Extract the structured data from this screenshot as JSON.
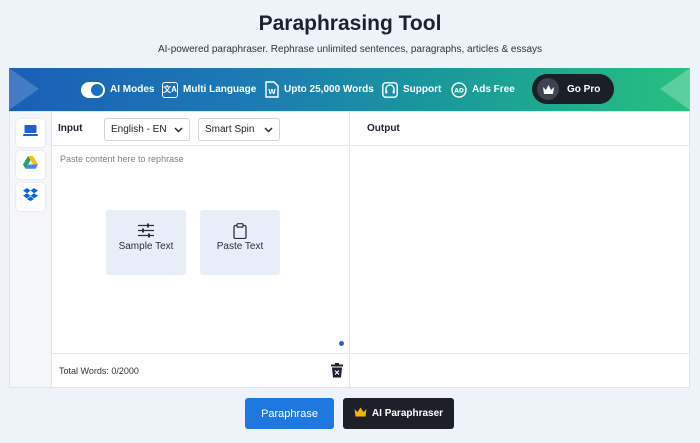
{
  "page": {
    "title": "Paraphrasing Tool",
    "subtitle": "AI-powered paraphraser. Rephrase unlimited sentences, paragraphs, articles & essays"
  },
  "banner": {
    "features": [
      {
        "label": "AI Modes",
        "icon": "toggle-icon"
      },
      {
        "label": "Multi Language",
        "icon": "translate-icon"
      },
      {
        "label": "Upto 25,000 Words",
        "icon": "word-doc-icon"
      },
      {
        "label": "Support",
        "icon": "headset-icon"
      },
      {
        "label": "Ads Free",
        "icon": "ad-block-icon"
      }
    ],
    "go_pro_label": "Go Pro"
  },
  "sidebar": {
    "items": [
      {
        "icon": "computer-icon"
      },
      {
        "icon": "google-drive-icon"
      },
      {
        "icon": "dropbox-icon"
      }
    ]
  },
  "input_pane": {
    "label": "Input",
    "language_select": "English - EN",
    "mode_select": "Smart Spin",
    "placeholder": "Paste content here to rephrase",
    "sample_text_label": "Sample Text",
    "paste_text_label": "Paste Text",
    "word_count": "Total Words: 0/2000"
  },
  "output_pane": {
    "label": "Output"
  },
  "actions": {
    "paraphrase_label": "Paraphrase",
    "ai_paraphraser_label": "AI Paraphraser"
  },
  "colors": {
    "primary_button": "#1f78e0",
    "dark_button": "#1d2028",
    "banner_start": "#1a5fb6",
    "banner_end": "#26c07e",
    "crown": "#f2b705"
  }
}
